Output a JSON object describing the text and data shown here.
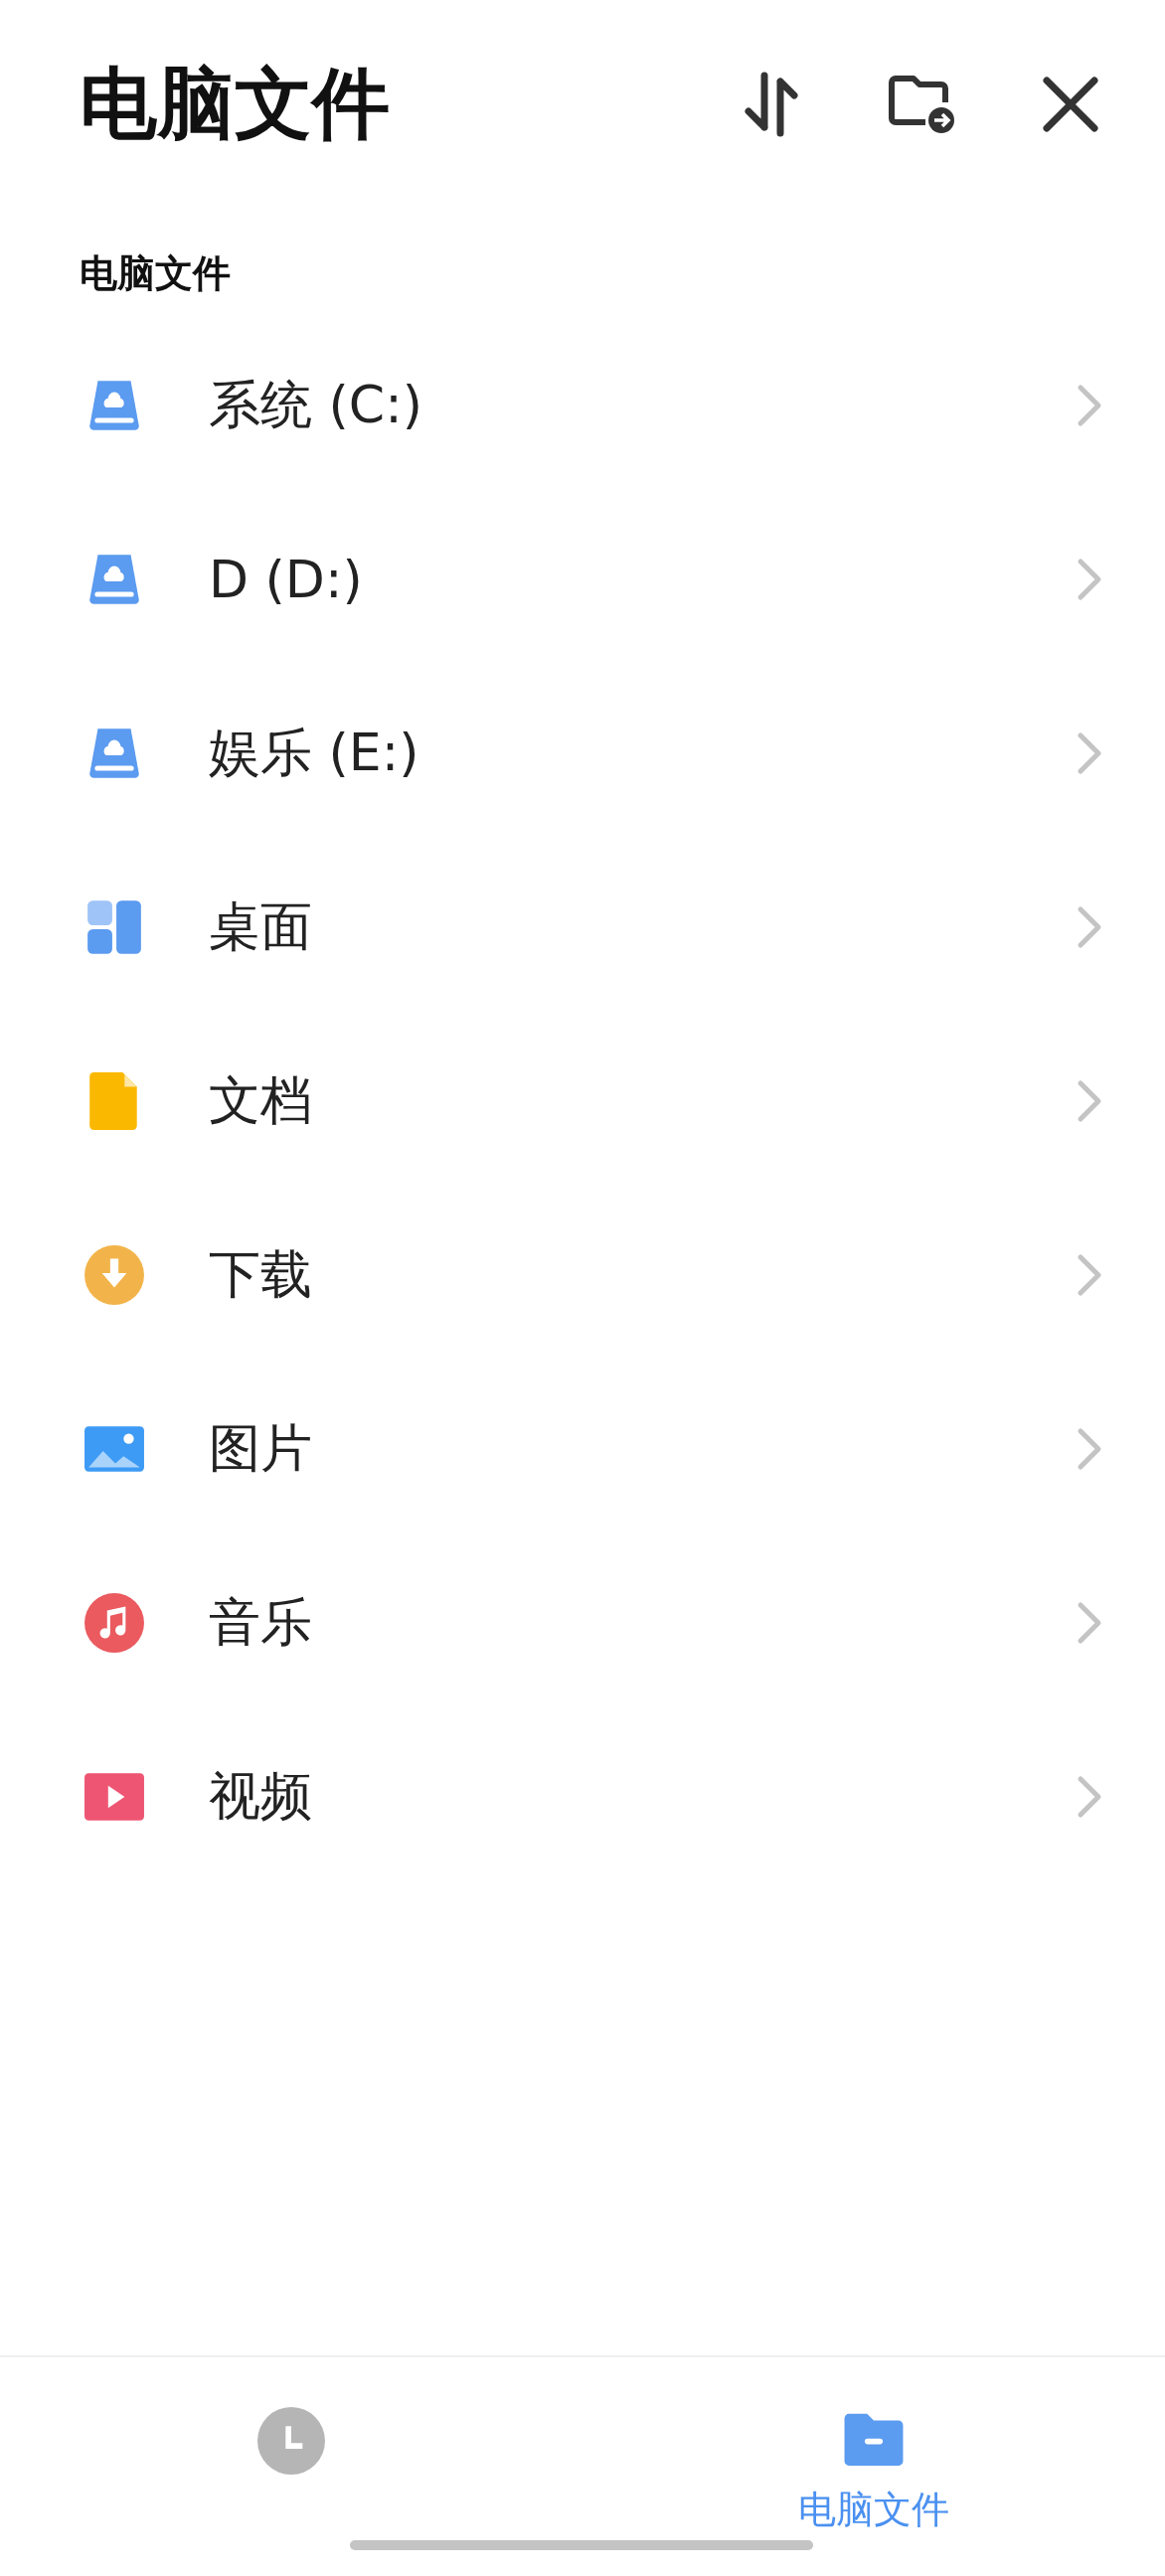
{
  "header": {
    "title": "电脑文件"
  },
  "section_label": "电脑文件",
  "items": [
    {
      "kind": "drive",
      "label": "系统 (C:)"
    },
    {
      "kind": "drive",
      "label": "D (D:)"
    },
    {
      "kind": "drive",
      "label": "娱乐 (E:)"
    },
    {
      "kind": "desktop",
      "label": "桌面"
    },
    {
      "kind": "document",
      "label": "文档"
    },
    {
      "kind": "download",
      "label": "下载"
    },
    {
      "kind": "picture",
      "label": "图片"
    },
    {
      "kind": "music",
      "label": "音乐"
    },
    {
      "kind": "video",
      "label": "视频"
    }
  ],
  "bottom_tabs": [
    {
      "kind": "recent",
      "selected": false
    },
    {
      "kind": "computer",
      "label": "电脑文件",
      "selected": true
    }
  ]
}
